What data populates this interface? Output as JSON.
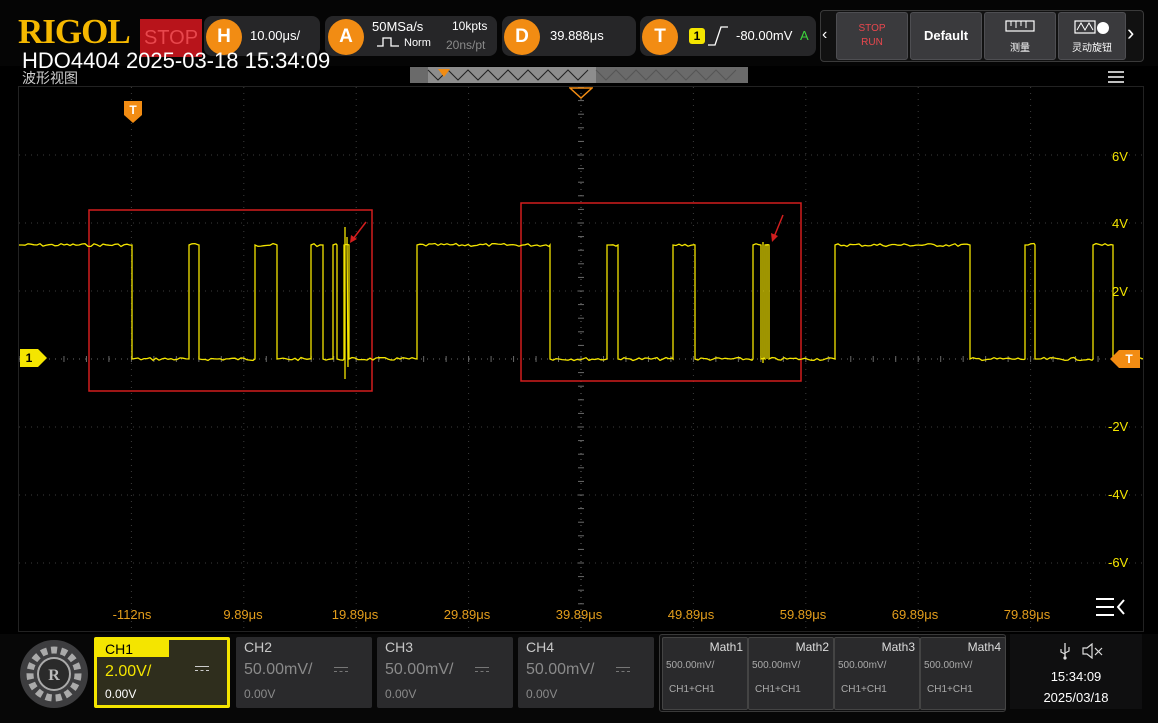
{
  "brand": "RIGOL",
  "run_state": "STOP",
  "model_line": "HDO4404 2025-03-18 15:34:09",
  "view_title": "波形视图",
  "horizontal": {
    "knob": "H",
    "timebase": "10.00μs/"
  },
  "acquire": {
    "knob": "A",
    "sample_rate": "50MSa/s",
    "mode": "Norm",
    "mem_depth": "10kpts",
    "interval": "20ns/pt"
  },
  "delay": {
    "knob": "D",
    "value": "39.888μs"
  },
  "trigger": {
    "knob": "T",
    "source": "1",
    "level": "-80.00mV",
    "sweep": "A"
  },
  "buttons": {
    "stop_run_top": "STOP",
    "stop_run_bottom": "RUN",
    "default_label": "Default",
    "measure": "测量",
    "knob_label": "灵动旋钮"
  },
  "volt_labels": [
    "6V",
    "4V",
    "2V",
    "-2V",
    "-4V",
    "-6V"
  ],
  "time_labels": [
    "-112ns",
    "9.89μs",
    "19.89μs",
    "29.89μs",
    "39.89μs",
    "49.89μs",
    "59.89μs",
    "69.89μs",
    "79.89μs"
  ],
  "ch1_marker": "1",
  "trig_marker": "T",
  "channels": [
    {
      "name": "CH1",
      "scale": "2.00V/",
      "offset": "0.00V"
    },
    {
      "name": "CH2",
      "scale": "50.00mV/",
      "offset": "0.00V"
    },
    {
      "name": "CH3",
      "scale": "50.00mV/",
      "offset": "0.00V"
    },
    {
      "name": "CH4",
      "scale": "50.00mV/",
      "offset": "0.00V"
    }
  ],
  "maths": [
    {
      "name": "Math1",
      "scale": "500.00mV/",
      "source": "CH1+CH1"
    },
    {
      "name": "Math2",
      "scale": "500.00mV/",
      "source": "CH1+CH1"
    },
    {
      "name": "Math3",
      "scale": "500.00mV/",
      "source": "CH1+CH1"
    },
    {
      "name": "Math4",
      "scale": "500.00mV/",
      "source": "CH1+CH1"
    }
  ],
  "clock": {
    "time": "15:34:09",
    "date": "2025/03/18"
  },
  "colors": {
    "ch1": "#f4e500",
    "accent": "#f28c13",
    "annotation": "#d21e1e",
    "stop": "#b8141b"
  }
}
